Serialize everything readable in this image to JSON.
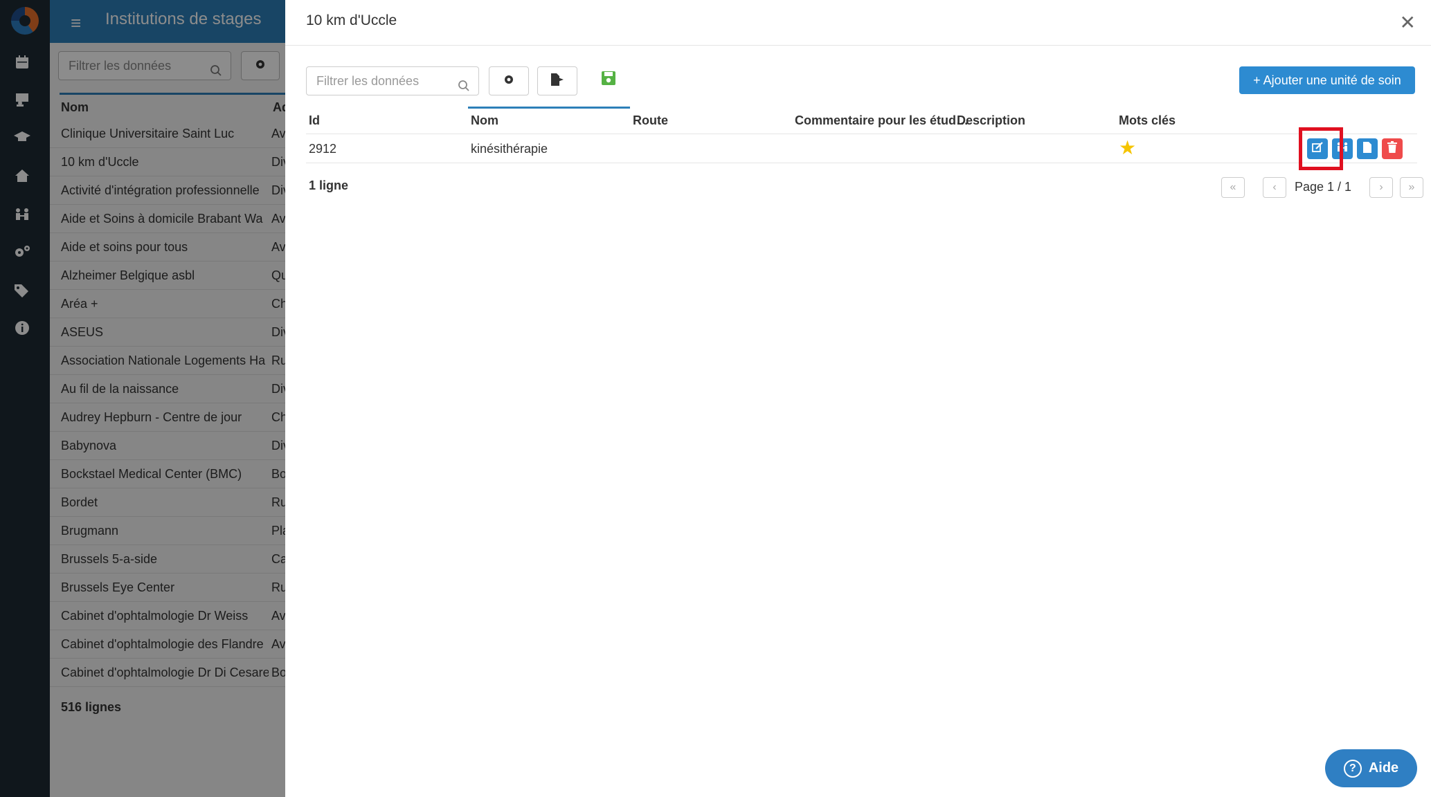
{
  "app": {
    "title": "Institutions de stages",
    "filter_placeholder": "Filtrer les données",
    "columns": [
      "Nom",
      "Ad"
    ],
    "rows": [
      {
        "nom": "Clinique Universitaire Saint Luc",
        "ad": "Av"
      },
      {
        "nom": "10 km d'Uccle",
        "ad": "Div"
      },
      {
        "nom": "Activité d'intégration professionnelle",
        "ad": "Div"
      },
      {
        "nom": "Aide et Soins à domicile Brabant Wa",
        "ad": "Av"
      },
      {
        "nom": "Aide et soins pour tous",
        "ad": "Av"
      },
      {
        "nom": "Alzheimer Belgique asbl",
        "ad": "Qu"
      },
      {
        "nom": "Aréa +",
        "ad": "Ch"
      },
      {
        "nom": "ASEUS",
        "ad": "Div"
      },
      {
        "nom": "Association Nationale Logements Ha",
        "ad": "Ru"
      },
      {
        "nom": "Au fil de la naissance",
        "ad": "Div"
      },
      {
        "nom": "Audrey Hepburn - Centre de jour",
        "ad": "Ch"
      },
      {
        "nom": "Babynova",
        "ad": "Div"
      },
      {
        "nom": "Bockstael Medical Center (BMC)",
        "ad": "Bo"
      },
      {
        "nom": "Bordet",
        "ad": "Ru"
      },
      {
        "nom": "Brugmann",
        "ad": "Pla"
      },
      {
        "nom": "Brussels 5-a-side",
        "ad": "Ca"
      },
      {
        "nom": "Brussels Eye Center",
        "ad": "Ru"
      },
      {
        "nom": "Cabinet d'ophtalmologie  Dr Weiss",
        "ad": "Av"
      },
      {
        "nom": "Cabinet d'ophtalmologie des Flandre",
        "ad": "Av"
      },
      {
        "nom": "Cabinet d'ophtalmologie Dr Di Cesare",
        "ad": "Bo"
      }
    ],
    "total": "516 lignes"
  },
  "modal": {
    "title": "10 km d'Uccle",
    "filter_placeholder": "Filtrer les données",
    "add_button": "+ Ajouter une unité de soin",
    "columns": {
      "id": "Id",
      "nom": "Nom",
      "route": "Route",
      "commentaire": "Commentaire pour les étud…",
      "description": "Description",
      "mots_cles": "Mots clés"
    },
    "row": {
      "id": "2912",
      "nom": "kinésithérapie",
      "route": "",
      "commentaire": "",
      "description": ""
    },
    "count": "1 ligne",
    "page": "Page 1 / 1"
  },
  "help": {
    "label": "Aide"
  },
  "colors": {
    "primary": "#2d8bd1",
    "danger": "#ef4b4b",
    "save": "#55b244",
    "rail": "#1e2b33",
    "highlight": "#e01020"
  }
}
